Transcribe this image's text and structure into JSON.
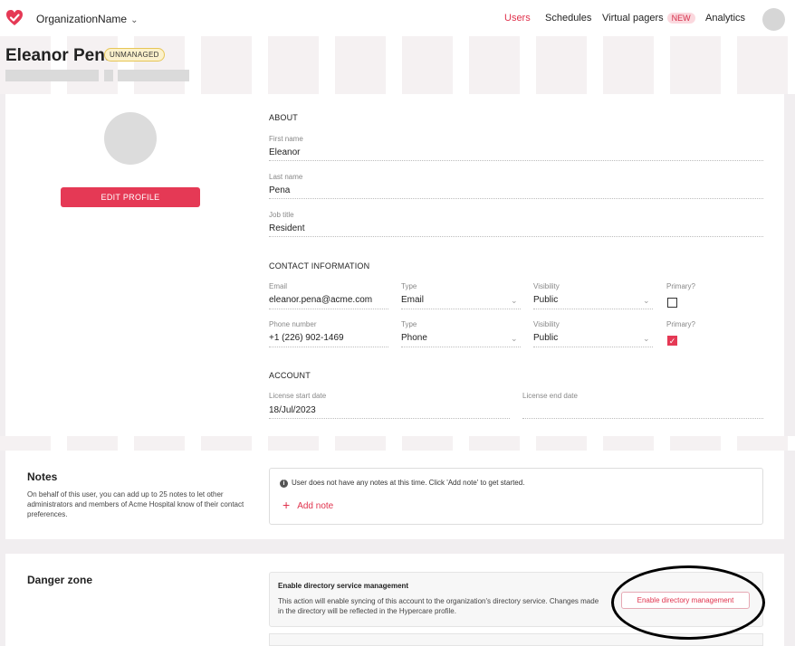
{
  "topnav": {
    "org_name": "OrganizationName",
    "org_chevron": "⌄",
    "items": [
      {
        "label": "Users",
        "active": true
      },
      {
        "label": "Schedules"
      },
      {
        "label": "Virtual pagers",
        "badge": "NEW"
      },
      {
        "label": "Analytics"
      }
    ],
    "accent": "#e0334d"
  },
  "header": {
    "name": "Eleanor Pena",
    "badge": "UNMANAGED"
  },
  "profile": {
    "edit_button": "EDIT PROFILE",
    "about": {
      "title": "ABOUT",
      "first_name_label": "First name",
      "first_name": "Eleanor",
      "last_name_label": "Last name",
      "last_name": "Pena",
      "job_title_label": "Job title",
      "job_title": "Resident"
    },
    "contact": {
      "title": "CONTACT INFORMATION",
      "rows": [
        {
          "value_label": "Email",
          "value": "eleanor.pena@acme.com",
          "type_label": "Type",
          "type": "Email",
          "visibility_label": "Visibility",
          "visibility": "Public",
          "primary_label": "Primary?",
          "primary": false
        },
        {
          "value_label": "Phone number",
          "value": "+1 (226) 902-1469",
          "type_label": "Type",
          "type": "Phone",
          "visibility_label": "Visibility",
          "visibility": "Public",
          "primary_label": "Primary?",
          "primary": true
        }
      ]
    },
    "account": {
      "title": "ACCOUNT",
      "start_label": "License start date",
      "start": "18/Jul/2023",
      "end_label": "License end date",
      "end": ""
    }
  },
  "notes": {
    "title": "Notes",
    "description": "On behalf of this user, you can add up to 25 notes to let other administrators and members of Acme Hospital know of their contact preferences.",
    "empty_message": "User does not have any notes at this time. Click 'Add note' to get started.",
    "add_label": "Add note"
  },
  "danger": {
    "title": "Danger zone",
    "heading": "Enable directory service management",
    "description": "This action will enable syncing of this account to the organization's directory service. Changes made in the directory will be reflected in the Hypercare profile.",
    "button": "Enable directory management"
  }
}
